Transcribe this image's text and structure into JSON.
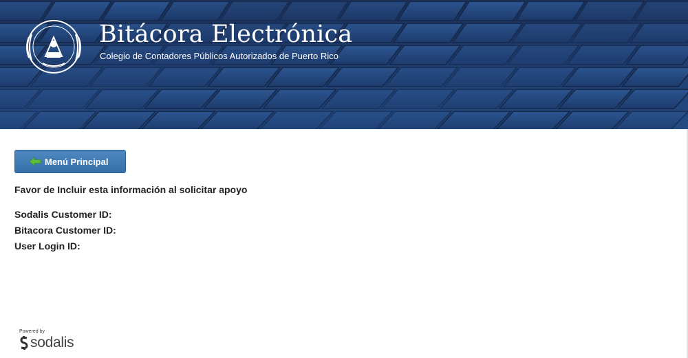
{
  "header": {
    "title": "Bitácora Electrónica",
    "subtitle": "Colegio de Contadores Públicos Autorizados de Puerto Rico"
  },
  "menu_button": {
    "label": "Menú Principal",
    "icon": "left-arrow-icon"
  },
  "support": {
    "heading": "Favor de Incluir esta información al solicitar apoyo",
    "fields": [
      {
        "label": "Sodalis Customer ID:",
        "value": ""
      },
      {
        "label": "Bitacora Customer ID:",
        "value": ""
      },
      {
        "label": "User Login ID:",
        "value": ""
      }
    ]
  },
  "footer": {
    "powered_by": "Powered by",
    "brand": "sodalis"
  },
  "colors": {
    "banner": "#1f3d70",
    "button": "#3f7bb5",
    "arrow": "#5cbf3a"
  }
}
